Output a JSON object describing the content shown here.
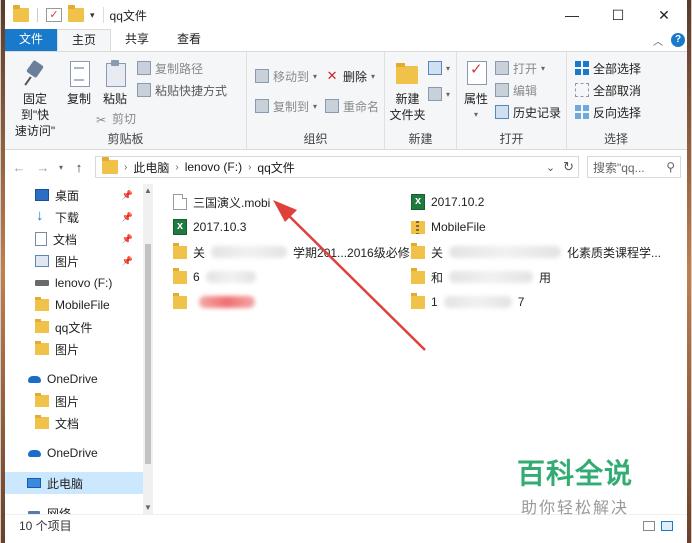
{
  "window": {
    "title": "qq文件",
    "controls": {
      "minimize": "—",
      "maximize": "☐",
      "close": "✕"
    }
  },
  "tabs": [
    {
      "label": "文件",
      "kind": "file"
    },
    {
      "label": "主页",
      "kind": "active"
    },
    {
      "label": "共享",
      "kind": "normal"
    },
    {
      "label": "查看",
      "kind": "normal"
    }
  ],
  "ribbon": {
    "clipboard": {
      "label": "剪贴板",
      "pin": "固定到\"快\n速访问\"",
      "copy": "复制",
      "paste": "粘贴",
      "copy_path": "复制路径",
      "paste_shortcut": "粘贴快捷方式",
      "cut": "剪切"
    },
    "organize": {
      "label": "组织",
      "move_to": "移动到",
      "copy_to": "复制到",
      "delete": "删除",
      "rename": "重命名"
    },
    "new": {
      "label": "新建",
      "new_folder": "新建\n文件夹"
    },
    "open": {
      "label": "打开",
      "properties": "属性",
      "open": "打开",
      "edit": "编辑",
      "history": "历史记录"
    },
    "select": {
      "label": "选择",
      "select_all": "全部选择",
      "select_none": "全部取消",
      "invert": "反向选择"
    }
  },
  "address": {
    "crumbs": [
      "此电脑",
      "lenovo (F:)",
      "qq文件"
    ],
    "search_placeholder": "搜索\"qq..."
  },
  "nav": [
    {
      "label": "桌面",
      "icon": "desktop",
      "pinned": true
    },
    {
      "label": "下载",
      "icon": "download",
      "pinned": true
    },
    {
      "label": "文档",
      "icon": "docs",
      "pinned": true
    },
    {
      "label": "图片",
      "icon": "pics",
      "pinned": true
    },
    {
      "label": "lenovo (F:)",
      "icon": "drive",
      "pinned": false
    },
    {
      "label": "MobileFile",
      "icon": "folder",
      "pinned": false
    },
    {
      "label": "qq文件",
      "icon": "folder",
      "pinned": false
    },
    {
      "label": "图片",
      "icon": "folder",
      "pinned": false
    },
    {
      "label": "OneDrive",
      "icon": "cloud",
      "pinned": false,
      "top": true
    },
    {
      "label": "图片",
      "icon": "folder",
      "pinned": false
    },
    {
      "label": "文档",
      "icon": "folder",
      "pinned": false
    },
    {
      "label": "OneDrive",
      "icon": "cloud",
      "pinned": false,
      "top": true
    },
    {
      "label": "此电脑",
      "icon": "pc",
      "pinned": false,
      "top": true,
      "selected": true
    },
    {
      "label": "网络",
      "icon": "net",
      "pinned": false,
      "top": true
    }
  ],
  "files": {
    "col1": [
      {
        "name": "三国演义.mobi",
        "icon": "doc"
      },
      {
        "name": "2017.10.3",
        "icon": "xls"
      },
      {
        "name": "关",
        "icon": "folder",
        "blur_mid": true,
        "suffix": "学期201...2016级必修..."
      },
      {
        "name": "6",
        "icon": "folder",
        "blur_mid": true,
        "suffix": ""
      },
      {
        "name": "",
        "icon": "folder",
        "blur_red": true,
        "suffix": ""
      }
    ],
    "col2": [
      {
        "name": "2017.10.2",
        "icon": "xls"
      },
      {
        "name": "MobileFile",
        "icon": "zip"
      },
      {
        "name": "关",
        "icon": "folder",
        "blur_mid": true,
        "suffix": "化素质类课程学..."
      },
      {
        "name": "和",
        "icon": "folder",
        "blur_mid": true,
        "suffix": "用"
      },
      {
        "name": "1",
        "icon": "folder",
        "blur_mid": true,
        "suffix": "7"
      }
    ]
  },
  "status": {
    "count": "10 个项目"
  },
  "watermark": {
    "main": "百科全说",
    "sub": "助你轻松解决"
  },
  "colors": {
    "accent": "#1979ca",
    "arrow": "#e0403a",
    "watermark": "#1ea464"
  }
}
